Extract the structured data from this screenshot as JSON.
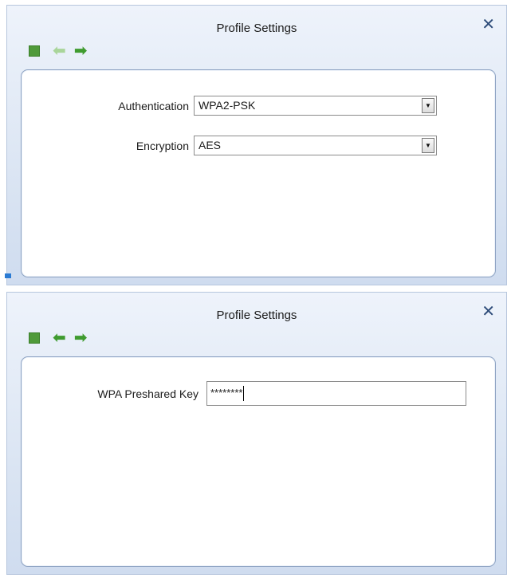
{
  "dialogs": [
    {
      "title": "Profile Settings",
      "close_glyph": "✕",
      "toolbar": {
        "stop_icon": "stop-icon",
        "back_icon": "back-arrow-icon",
        "forward_icon": "forward-arrow-icon",
        "back_enabled": false
      },
      "fields": {
        "authentication": {
          "label": "Authentication",
          "value": "WPA2-PSK"
        },
        "encryption": {
          "label": "Encryption",
          "value": "AES"
        }
      }
    },
    {
      "title": "Profile Settings",
      "close_glyph": "✕",
      "toolbar": {
        "stop_icon": "stop-icon",
        "back_icon": "back-arrow-icon",
        "forward_icon": "forward-arrow-icon",
        "back_enabled": true
      },
      "fields": {
        "wpa_key": {
          "label": "WPA Preshared Key",
          "value": "********"
        }
      }
    }
  ],
  "colors": {
    "accent_green": "#3f9b2f",
    "disabled_green": "#9fcf8e",
    "close_blue": "#2e4c79"
  }
}
